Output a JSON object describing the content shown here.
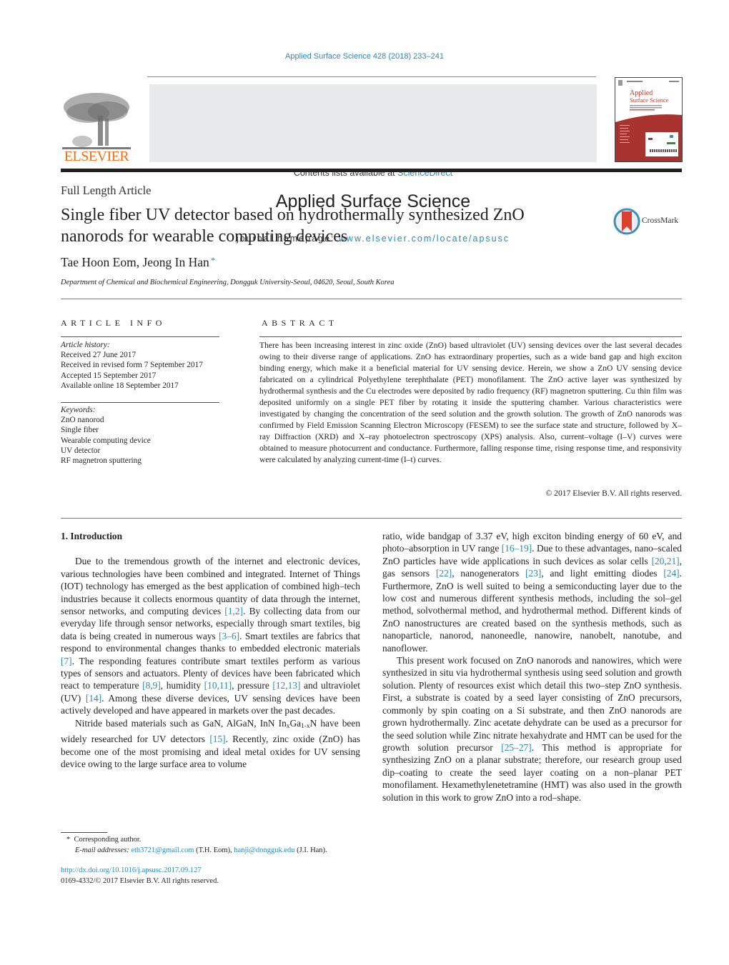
{
  "header": {
    "journal_ref": "Applied Surface Science 428 (2018) 233–241",
    "contents_prefix": "Contents lists available at ",
    "contents_link": "ScienceDirect",
    "journal_title": "Applied Surface Science",
    "homepage_prefix": "journal homepage: ",
    "homepage_link": "www.elsevier.com/locate/apsusc",
    "publisher_logo_text": "ELSEVIER",
    "cover_title_line1": "Applied",
    "cover_title_line2": "Surface Science"
  },
  "colors": {
    "link": "#2a8ab4",
    "elsevier_orange": "#e9711c",
    "banner_gray": "#e8e9ea",
    "cover_red": "#a8322d",
    "crossmark_red": "#d9402e",
    "crossmark_ring": "#3d8fb5"
  },
  "article": {
    "type": "Full Length Article",
    "title": "Single fiber UV detector based on hydrothermally synthesized ZnO nanorods for wearable computing devices",
    "authors": "Tae Hoon Eom, Jeong In Han",
    "author_mark": "*",
    "affiliation": "Department of Chemical and Biochemical Engineering, Dongguk University-Seoul, 04620, Seoul, South Korea",
    "crossmark_label": "CrossMark"
  },
  "article_info": {
    "heading": "ARTICLE INFO",
    "history_label": "Article history:",
    "history": [
      "Received 27 June 2017",
      "Received in revised form 7 September 2017",
      "Accepted 15 September 2017",
      "Available online 18 September 2017"
    ],
    "keywords_label": "Keywords:",
    "keywords": [
      "ZnO nanorod",
      "Single fiber",
      "Wearable computing device",
      "UV detector",
      "RF magnetron sputtering"
    ]
  },
  "abstract": {
    "heading": "ABSTRACT",
    "text": "There has been increasing interest in zinc oxide (ZnO) based ultraviolet (UV) sensing devices over the last several decades owing to their diverse range of applications. ZnO has extraordinary properties, such as a wide band gap and high exciton binding energy, which make it a beneficial material for UV sensing device. Herein, we show a ZnO UV sensing device fabricated on a cylindrical Polyethylene terephthalate (PET) monofilament. The ZnO active layer was synthesized by hydrothermal synthesis and the Cu electrodes were deposited by radio frequency (RF) magnetron sputtering. Cu thin film was deposited uniformly on a single PET fiber by rotating it inside the sputtering chamber. Various characteristics were investigated by changing the concentration of the seed solution and the growth solution. The growth of ZnO nanorods was confirmed by Field Emission Scanning Electron Microscopy (FESEM) to see the surface state and structure, followed by X–ray Diffraction (XRD) and X–ray photoelectron spectroscopy (XPS) analysis. Also, current–voltage (I–V) curves were obtained to measure photocurrent and conductance. Furthermore, falling response time, rising response time, and responsivity were calculated by analyzing current-time (I–t) curves.",
    "copyright": "© 2017 Elsevier B.V. All rights reserved."
  },
  "body": {
    "section_heading": "1.  Introduction",
    "p1": [
      "Due to the tremendous growth of the internet and electronic devices, various technologies have been combined and integrated. Internet of Things (IOT) technology has emerged as the best application of combined high–tech industries because it collects enormous quantity of data through the internet, sensor networks, and computing devices ",
      "[1,2]",
      ". By collecting data from our everyday life through sensor networks, especially through smart textiles, big data is being created in numerous ways ",
      "[3–6]",
      ". Smart textiles are fabrics that respond to environmental changes thanks to embedded electronic materials ",
      "[7]",
      ". The responding features contribute smart textiles perform as various types of sensors and actuators. Plenty of devices have been fabricated which react to temperature ",
      "[8,9]",
      ", humidity ",
      "[10,11]",
      ", pressure ",
      "[12,13]",
      " and ultraviolet (UV) ",
      "[14]",
      ". Among these diverse devices, UV sensing devices have been actively developed and have appeared in markets over the past decades."
    ],
    "p2": {
      "a": "Nitride based materials such as GaN, AlGaN, InN In",
      "sub1": "x",
      "b": "Ga",
      "sub2": "1-x",
      "c": "N have been widely researched for UV detectors ",
      "ref": "[15]",
      "d": ". Recently, zinc oxide (ZnO) has become one of the most promising and ideal metal oxides for UV sensing device owing to the large surface area to volume"
    },
    "p3": [
      "ratio, wide bandgap of 3.37 eV, high exciton binding energy of 60 eV, and photo–absorption in UV range ",
      "[16–19]",
      ". Due to these advantages, nano–scaled ZnO particles have wide applications in such devices as solar cells ",
      "[20,21]",
      ", gas sensors ",
      "[22]",
      ", nanogenerators ",
      "[23]",
      ", and light emitting diodes ",
      "[24]",
      ". Furthermore, ZnO is well suited to being a semiconducting layer due to the low cost and numerous different synthesis methods, including the sol–gel method, solvothermal method, and hydrothermal method. Different kinds of ZnO nanostructures are created based on the synthesis methods, such as nanoparticle, nanorod, nanoneedle, nanowire, nanobelt, nanotube, and nanoflower."
    ],
    "p4": [
      "This present work focused on ZnO nanorods and nanowires, which were synthesized in situ via hydrothermal synthesis using seed solution and growth solution. Plenty of resources exist which detail this two–step ZnO synthesis. First, a substrate is coated by a seed layer consisting of ZnO precursors, commonly by spin coating on a Si substrate, and then ZnO nanorods are grown hydrothermally. Zinc acetate dehydrate can be used as a precursor for the seed solution while Zinc nitrate hexahydrate and HMT can be used for the growth solution precursor ",
      "[25–27]",
      ". This method is appropriate for synthesizing ZnO on a planar substrate; therefore, our research group used dip–coating to create the seed layer coating on a non–planar PET monofilament. Hexamethylenetetramine (HMT) was also used in the growth solution in this work to grow ZnO into a rod–shape."
    ]
  },
  "footnote": {
    "mark": "*",
    "corresponding": "Corresponding author.",
    "email_label": "E-mail addresses:",
    "email1": "eth3721@gmail.com",
    "email1_owner": " (T.H. Eom), ",
    "email2": "hanji@dongguk.edu",
    "email2_owner": " (J.I. Han)."
  },
  "doi": {
    "link": "http://dx.doi.org/10.1016/j.apsusc.2017.09.127",
    "issn_line": "0169-4332/© 2017 Elsevier B.V. All rights reserved."
  }
}
